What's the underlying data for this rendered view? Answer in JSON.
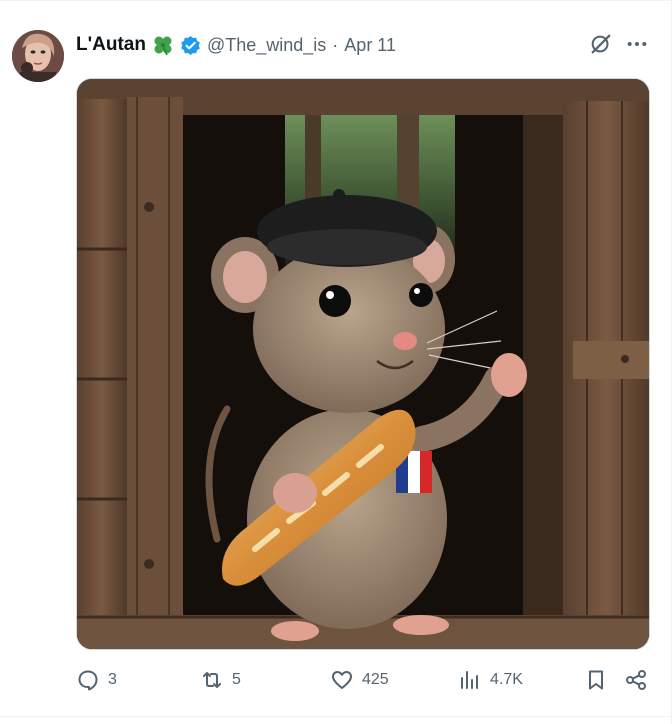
{
  "tweet": {
    "author_name": "L'Autan",
    "author_emoji": "🍀",
    "handle": "@The_wind_is",
    "separator": "·",
    "date": "Apr 11",
    "verified": true,
    "media": {
      "description_icon": "image",
      "flag_colors": [
        "#1f3c8f",
        "#ffffff",
        "#d62828"
      ]
    }
  },
  "actions": {
    "replies": "3",
    "reposts": "5",
    "likes": "425",
    "views": "4.7K"
  },
  "colors": {
    "text_primary": "#0f1419",
    "text_secondary": "#536471",
    "verified_blue": "#1d9bf0",
    "border": "#cfd9de"
  }
}
